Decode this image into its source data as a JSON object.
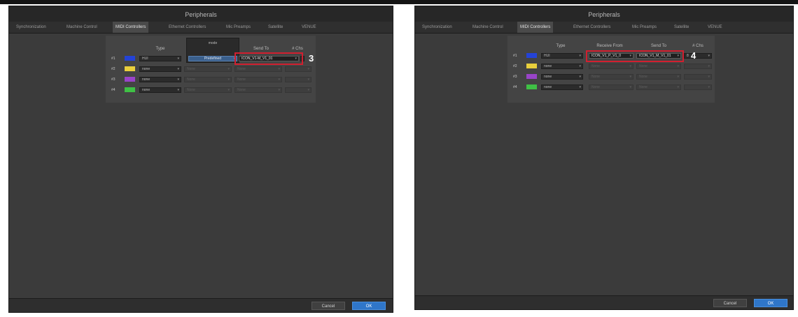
{
  "left": {
    "title": "Peripherals",
    "tabs": [
      "Synchronization",
      "Machine Control",
      "MIDI Controllers",
      "Ethernet Controllers",
      "Mic Preamps",
      "Satellite",
      "VENUE"
    ],
    "active_tab": "MIDI Controllers",
    "headers": {
      "type": "Type",
      "mode": "mode",
      "send_to": "Send To",
      "num_chs": "# Chs"
    },
    "mode_value": "Predefined",
    "send_to_value": "ICON_V1-M_V1_01",
    "callout": "3",
    "rows": [
      {
        "label": "#1",
        "color": "#2443d6",
        "type": "HUI",
        "mode": "Predefined",
        "send": "ICON_V1-M_V1_01",
        "chs": ""
      },
      {
        "label": "#2",
        "color": "#e9cf3c",
        "type": "none",
        "mode": "None",
        "send": "None",
        "chs": ""
      },
      {
        "label": "#3",
        "color": "#9944c8",
        "type": "none",
        "mode": "None",
        "send": "None",
        "chs": ""
      },
      {
        "label": "#4",
        "color": "#3fc145",
        "type": "none",
        "mode": "None",
        "send": "None",
        "chs": ""
      }
    ],
    "cancel_label": "Cancel",
    "ok_label": "OK"
  },
  "right": {
    "title": "Peripherals",
    "tabs": [
      "Synchronization",
      "Machine Control",
      "MIDI Controllers",
      "Ethernet Controllers",
      "Mic Preamps",
      "Satellite",
      "VENUE"
    ],
    "active_tab": "MIDI Controllers",
    "headers": {
      "type": "Type",
      "receive_from": "Receive From",
      "send_to": "Send To",
      "num_chs": "# Chs"
    },
    "callout": "4",
    "rows": [
      {
        "label": "#1",
        "color": "#2443d6",
        "type": "HUI",
        "receive": "ICON_V1_P_V1_0",
        "send": "ICON_V1_M_V1_01",
        "chs": "8"
      },
      {
        "label": "#2",
        "color": "#e9cf3c",
        "type": "none",
        "receive": "None",
        "send": "None",
        "chs": ""
      },
      {
        "label": "#3",
        "color": "#9944c8",
        "type": "none",
        "receive": "None",
        "send": "None",
        "chs": ""
      },
      {
        "label": "#4",
        "color": "#3fc145",
        "type": "none",
        "receive": "None",
        "send": "None",
        "chs": ""
      }
    ],
    "cancel_label": "Cancel",
    "ok_label": "OK"
  },
  "colors": {
    "highlight": "#d21f2f",
    "ok_button": "#2f76c9"
  }
}
